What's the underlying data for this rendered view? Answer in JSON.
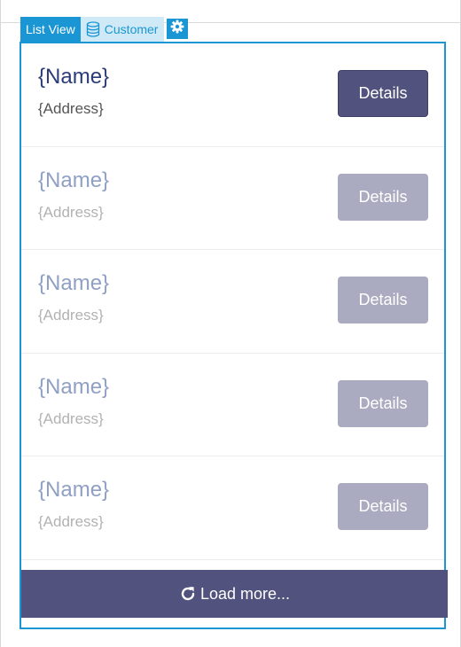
{
  "tabs": {
    "list_view": "List View",
    "customer": "Customer"
  },
  "icons": {
    "customer_tab": "database-icon",
    "settings_tab": "gear-icon",
    "load_more": "refresh-icon"
  },
  "colors": {
    "accent": "#1a96d4",
    "button": "#51527d",
    "button_faded": "#aaaac0",
    "name": "#2a3b7a",
    "name_faded": "#8fa0c4"
  },
  "list": {
    "rows": [
      {
        "name": "{Name}",
        "address": "{Address}",
        "button": "Details"
      },
      {
        "name": "{Name}",
        "address": "{Address}",
        "button": "Details"
      },
      {
        "name": "{Name}",
        "address": "{Address}",
        "button": "Details"
      },
      {
        "name": "{Name}",
        "address": "{Address}",
        "button": "Details"
      },
      {
        "name": "{Name}",
        "address": "{Address}",
        "button": "Details"
      }
    ],
    "load_more": "Load more..."
  }
}
